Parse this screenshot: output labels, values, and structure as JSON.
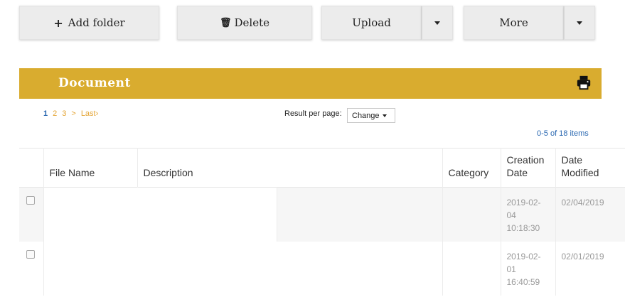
{
  "toolbar": {
    "add_folder": "Add folder",
    "delete": "Delete",
    "upload": "Upload",
    "more": "More"
  },
  "panel": {
    "title": "Document"
  },
  "pager": {
    "pages": [
      "1",
      "2",
      "3"
    ],
    "current": "1",
    "next": ">",
    "last": "Last›"
  },
  "per_page": {
    "label": "Result per page:",
    "select": "Change"
  },
  "count": "0-5 of 18 items",
  "table": {
    "headers": {
      "file_name": "File Name",
      "description": "Description",
      "category": "Category",
      "creation_date": "Creation Date",
      "date_modified": "Date Modified"
    },
    "rows": [
      {
        "file_name": "",
        "description": "",
        "category": "",
        "creation_date": "2019-02-04 10:18:30",
        "date_modified": "02/04/2019"
      },
      {
        "file_name": "",
        "description": "",
        "category": "",
        "creation_date": "2019-02-01 16:40:59",
        "date_modified": "02/01/2019"
      }
    ]
  },
  "colors": {
    "accent": "#d9ac2f",
    "link": "#2766b0",
    "pager_link": "#e4a433"
  }
}
